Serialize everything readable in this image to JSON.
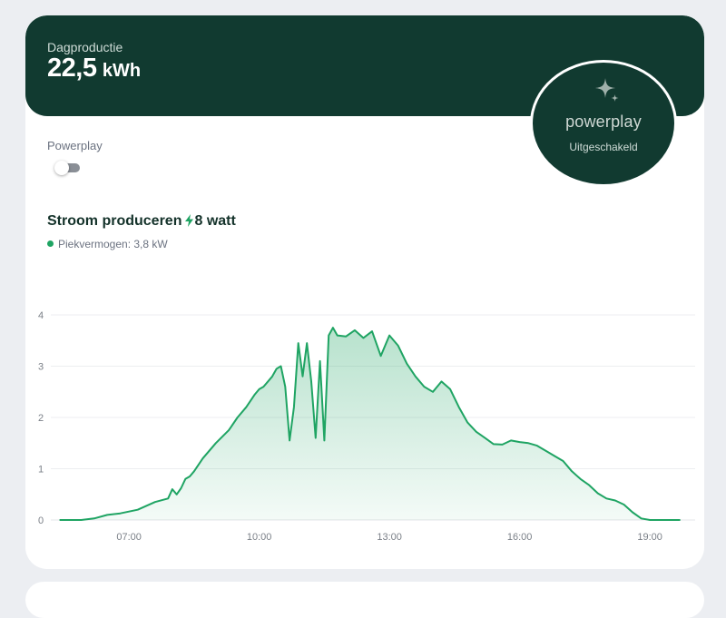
{
  "header": {
    "label": "Dagproductie",
    "value": "22,5",
    "unit": "kWh"
  },
  "powerplay_badge": {
    "logo": "powerplay",
    "status": "Uitgeschakeld",
    "icon": "sparkle-icon"
  },
  "powerplay_toggle": {
    "label": "Powerplay",
    "on": false
  },
  "chart_section": {
    "title": "Stroom produceren",
    "current": "8 watt",
    "legend": "Piekvermogen: 3,8 kW"
  },
  "colors": {
    "header_bg": "#113a30",
    "line": "#1fa463",
    "page_bg": "#eceef2"
  },
  "chart_data": {
    "type": "area",
    "title": "",
    "xlabel": "",
    "ylabel": "",
    "x_unit": "hour of day",
    "xlim": [
      5.2,
      20.0
    ],
    "ylim": [
      0,
      4
    ],
    "x_ticks": [
      7,
      10,
      13,
      16,
      19
    ],
    "x_tick_labels": [
      "07:00",
      "10:00",
      "13:00",
      "16:00",
      "19:00"
    ],
    "y_ticks": [
      0,
      1,
      2,
      3,
      4
    ],
    "y_tick_labels": [
      "0",
      "1",
      "2",
      "3",
      "4"
    ],
    "grid": true,
    "series": [
      {
        "x": [
          5.4,
          5.9,
          6.2,
          6.5,
          6.8,
          7.2,
          7.6,
          7.9,
          8.0,
          8.1,
          8.2,
          8.3,
          8.4,
          8.5,
          8.7,
          9.0,
          9.3,
          9.5,
          9.7,
          9.9,
          10.0,
          10.1,
          10.3,
          10.4,
          10.5,
          10.6,
          10.7,
          10.8,
          10.9,
          11.0,
          11.1,
          11.2,
          11.3,
          11.4,
          11.5,
          11.6,
          11.7,
          11.8,
          12.0,
          12.2,
          12.4,
          12.6,
          12.8,
          13.0,
          13.2,
          13.4,
          13.6,
          13.8,
          14.0,
          14.2,
          14.4,
          14.6,
          14.8,
          15.0,
          15.2,
          15.4,
          15.6,
          15.8,
          16.0,
          16.2,
          16.4,
          16.6,
          16.8,
          17.0,
          17.2,
          17.4,
          17.6,
          17.8,
          18.0,
          18.2,
          18.4,
          18.6,
          18.8,
          19.0,
          19.4,
          19.7
        ],
        "values": [
          0,
          0,
          0.03,
          0.1,
          0.13,
          0.2,
          0.35,
          0.42,
          0.6,
          0.5,
          0.62,
          0.8,
          0.85,
          0.95,
          1.2,
          1.5,
          1.75,
          2.0,
          2.2,
          2.45,
          2.55,
          2.6,
          2.8,
          2.95,
          3.0,
          2.6,
          1.55,
          2.2,
          3.45,
          2.8,
          3.45,
          2.7,
          1.6,
          3.1,
          1.55,
          3.6,
          3.75,
          3.6,
          3.58,
          3.7,
          3.55,
          3.68,
          3.2,
          3.6,
          3.4,
          3.05,
          2.8,
          2.6,
          2.5,
          2.7,
          2.55,
          2.2,
          1.9,
          1.72,
          1.6,
          1.48,
          1.47,
          1.55,
          1.52,
          1.5,
          1.45,
          1.35,
          1.25,
          1.15,
          0.95,
          0.8,
          0.68,
          0.52,
          0.42,
          0.38,
          0.3,
          0.15,
          0.03,
          0,
          0,
          0
        ]
      }
    ]
  }
}
